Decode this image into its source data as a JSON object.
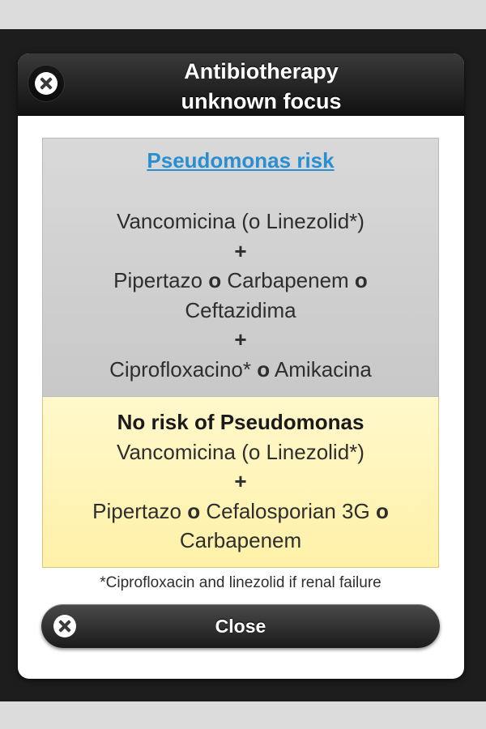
{
  "dialog": {
    "title_line1": "Antibiotherapy",
    "title_line2": "unknown focus",
    "header_close_icon": "close-icon"
  },
  "pseudomonas_risk": {
    "heading": "Pseudomonas risk",
    "line1": "Vancomicina (o Linezolid*)",
    "plus1": "+",
    "line2_a": "Pipertazo",
    "line2_conj1": "o",
    "line2_b": "Carbapenem",
    "line2_conj2": "o",
    "line3": "Ceftazidima",
    "plus2": "+",
    "line4_a": "Ciprofloxacino*",
    "line4_conj": "o",
    "line4_b": "Amikacina",
    "colors": {
      "background": "#d0d0d0",
      "heading": "#2a8fd1"
    }
  },
  "no_risk": {
    "title": "No risk of Pseudomonas",
    "line1": "Vancomicina (o Linezolid*)",
    "plus": "+",
    "line2_a": "Pipertazo",
    "line2_conj1": "o",
    "line2_b": "Cefalosporian 3G",
    "line2_conj2": "o",
    "line3": "Carbapenem",
    "colors": {
      "background": "#fff4b8"
    }
  },
  "footnote": "*Ciprofloxacin and linezolid if renal failure",
  "close_button": {
    "label": "Close",
    "icon": "close-icon"
  }
}
